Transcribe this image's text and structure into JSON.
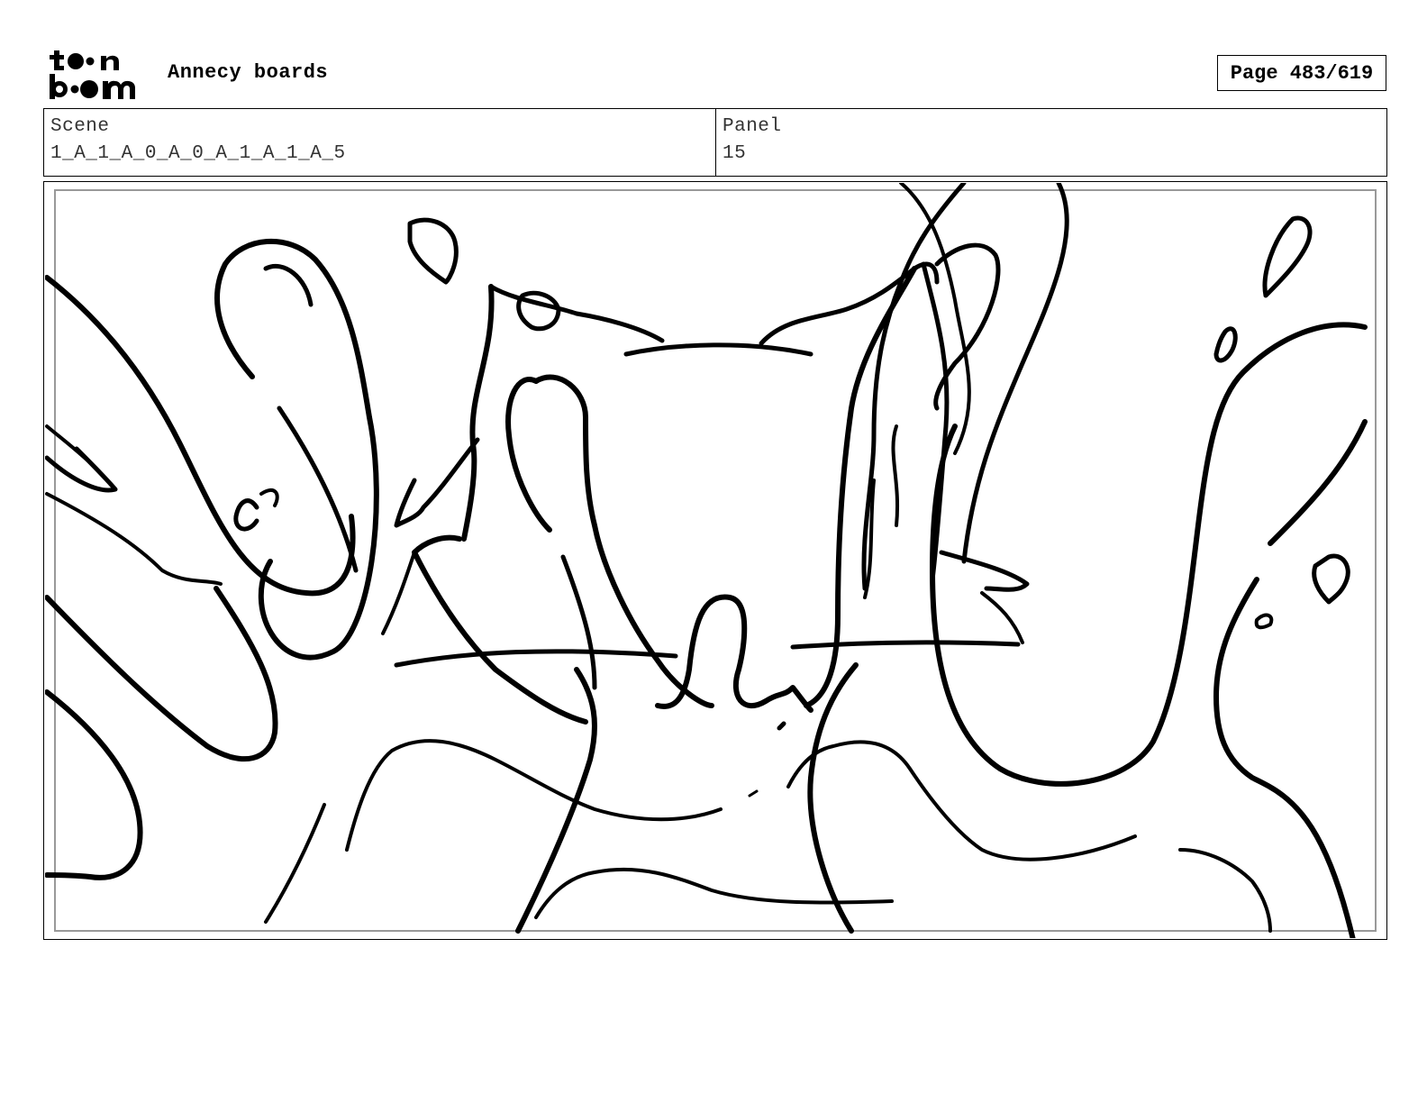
{
  "header": {
    "logo_text_top": "toon",
    "logo_text_bottom": "boom",
    "title": "Annecy boards",
    "page_label": "Page 483/619"
  },
  "info": {
    "scene_label": "Scene",
    "scene_value": "1_A_1_A_0_A_0_A_1_A_1_A_5",
    "panel_label": "Panel",
    "panel_value": "15"
  },
  "colors": {
    "ink": "#000000",
    "frame_inner": "#999999",
    "background": "#ffffff"
  },
  "panel_image": {
    "icon": "storyboard-sketch-icon"
  }
}
